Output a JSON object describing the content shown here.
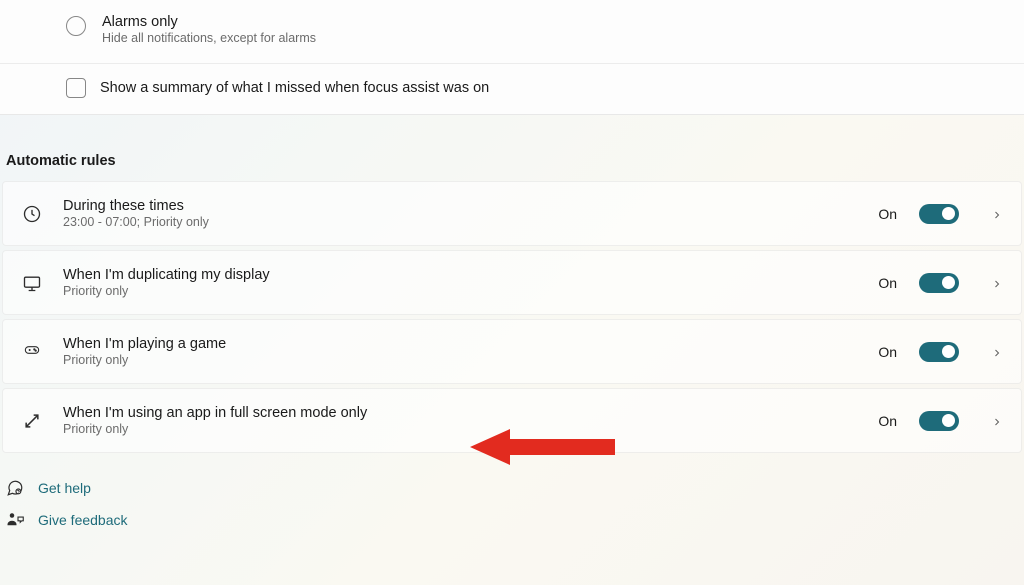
{
  "focus_options": {
    "alarms_only": {
      "title": "Alarms only",
      "subtitle": "Hide all notifications, except for alarms"
    },
    "summary_checkbox": {
      "label": "Show a summary of what I missed when focus assist was on"
    }
  },
  "section_header": "Automatic rules",
  "rules": [
    {
      "title": "During these times",
      "subtitle": "23:00 - 07:00; Priority only",
      "status": "On"
    },
    {
      "title": "When I'm duplicating my display",
      "subtitle": "Priority only",
      "status": "On"
    },
    {
      "title": "When I'm playing a game",
      "subtitle": "Priority only",
      "status": "On"
    },
    {
      "title": "When I'm using an app in full screen mode only",
      "subtitle": "Priority only",
      "status": "On"
    }
  ],
  "footer": {
    "get_help": "Get help",
    "give_feedback": "Give feedback"
  },
  "colors": {
    "accent": "#1e6b7a",
    "annotation": "#e22b1f"
  }
}
